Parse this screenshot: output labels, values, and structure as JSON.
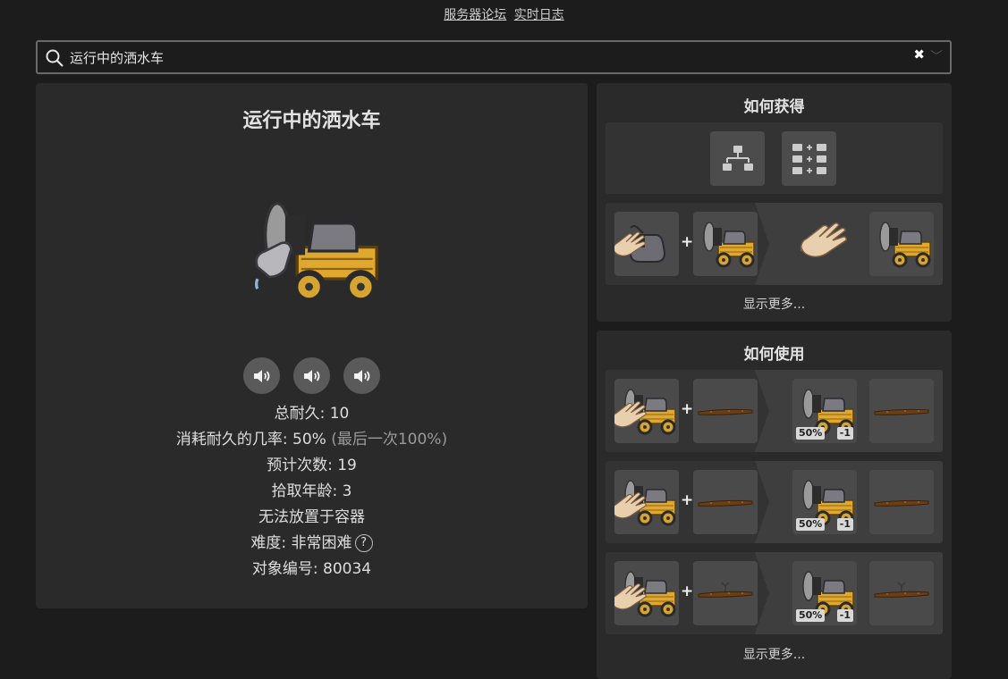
{
  "top_links": {
    "forum": "服务器论坛",
    "log": "实时日志"
  },
  "search": {
    "value": "运行中的洒水车",
    "clear_glyph": "✖",
    "chevron_glyph": "﹀"
  },
  "item": {
    "title": "运行中的洒水车",
    "stats": {
      "durability": "总耐久: 10",
      "consume_rate": "消耗耐久的几率: 50%",
      "consume_rate_last": "(最后一次100%)",
      "estimated_uses": "预计次数: 19",
      "pickup_age": "拾取年龄: 3",
      "no_container": "无法放置于容器",
      "difficulty": "难度: 非常困难",
      "help": "?",
      "object_id": "对象编号: 80034"
    }
  },
  "obtain": {
    "title": "如何获得",
    "show_more": "显示更多..."
  },
  "use": {
    "title": "如何使用",
    "badges": {
      "chance": "50%",
      "minus": "-1"
    },
    "show_more": "显示更多..."
  },
  "plus_sign": "+",
  "colors": {
    "background": "#1c1c1c",
    "panel": "#2a2a2a",
    "slot": "#4a4a4a",
    "cart_yellow": "#e0a82c"
  }
}
